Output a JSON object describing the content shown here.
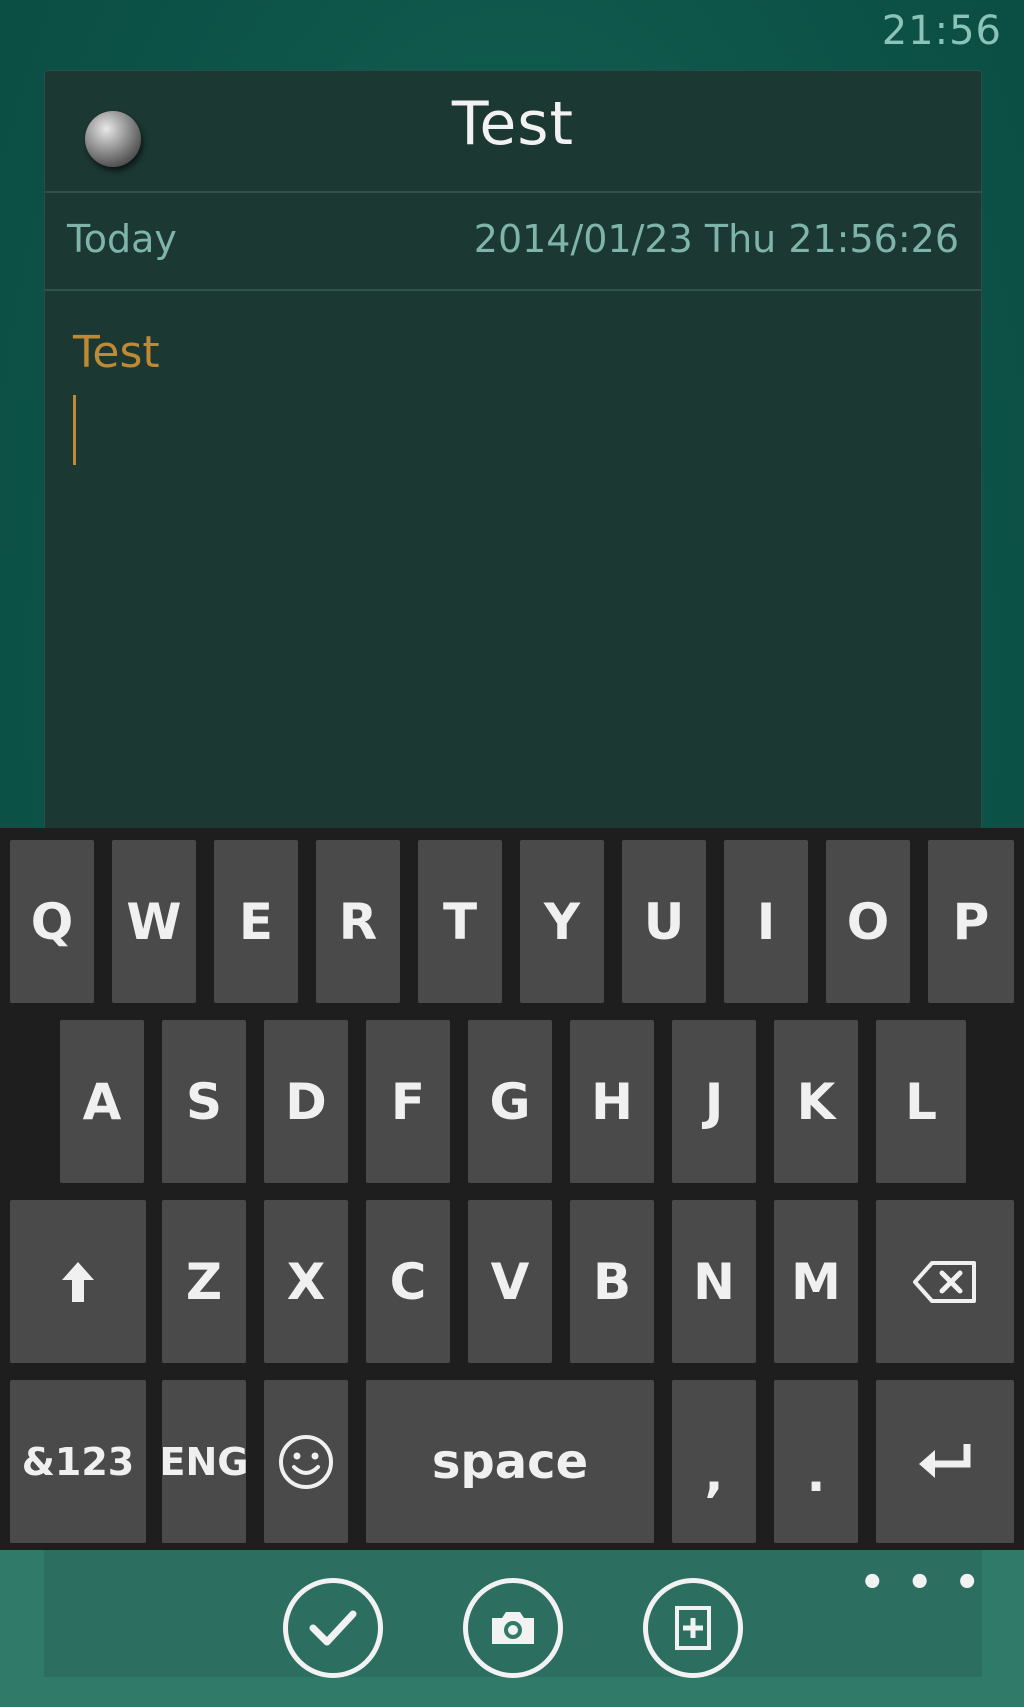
{
  "status_bar": {
    "time": "21:56"
  },
  "note": {
    "title": "Test",
    "date_label": "Today",
    "date_value": "2014/01/23 Thu 21:56:26",
    "body_text": "Test"
  },
  "keyboard": {
    "row1": [
      "Q",
      "W",
      "E",
      "R",
      "T",
      "Y",
      "U",
      "I",
      "O",
      "P"
    ],
    "row2": [
      "A",
      "S",
      "D",
      "F",
      "G",
      "H",
      "J",
      "K",
      "L"
    ],
    "row3": [
      "Z",
      "X",
      "C",
      "V",
      "B",
      "N",
      "M"
    ],
    "symbols_label": "&123",
    "language_label": "ENG",
    "space_label": "space",
    "comma_label": ",",
    "period_label": ".",
    "icons": {
      "shift": "shift-arrow-icon",
      "backspace": "backspace-icon",
      "emoji": "smiley-icon",
      "enter": "enter-icon"
    }
  },
  "app_bar": {
    "buttons": [
      "check-icon",
      "camera-icon",
      "add-page-icon"
    ],
    "more": "ellipsis-icon"
  },
  "colors": {
    "background": "#0d5449",
    "panel": "#1c3833",
    "accent_text": "#7fb4ab",
    "note_text": "#c08a34",
    "key": "#4a4a4a",
    "keyboard_bg": "#1e1e1e",
    "app_bar": "#2f7a69"
  }
}
